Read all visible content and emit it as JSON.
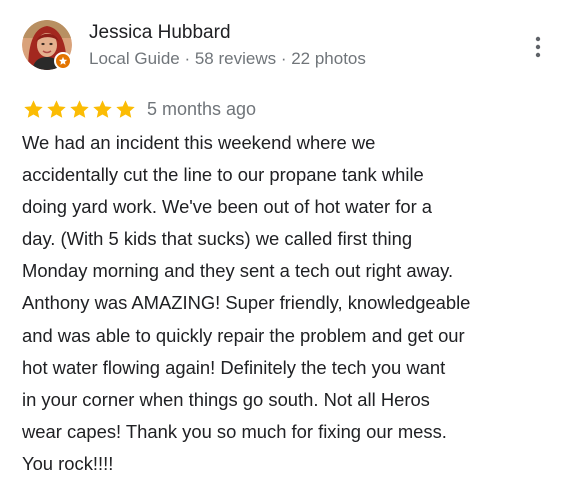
{
  "reviewer": {
    "name": "Jessica Hubbard",
    "meta": "Local Guide · 58 reviews · 22 photos",
    "avatar_icon": "profile-photo",
    "badge_icon": "local-guide-star-icon"
  },
  "menu": {
    "icon": "more-vert-icon"
  },
  "rating": {
    "stars": 5,
    "max_stars": 5,
    "star_color": "#fbbc04",
    "date": "5 months ago"
  },
  "review": {
    "text": "We had an incident this weekend where we\naccidentally cut the line to our propane tank while\ndoing yard work.  We've been out of hot water for a\nday. (With 5 kids that sucks) we called first thing\nMonday morning and they sent a tech out right away.\nAnthony was AMAZING!  Super friendly, knowledgeable\nand was able to quickly repair the problem and get our\nhot water flowing again!  Definitely the tech you want\nin your corner when things go south.  Not all Heros\nwear capes! Thank you so much for fixing our mess.\nYou rock!!!!"
  },
  "colors": {
    "primary_text": "#202124",
    "secondary_text": "#70757a",
    "badge": "#e37400"
  }
}
